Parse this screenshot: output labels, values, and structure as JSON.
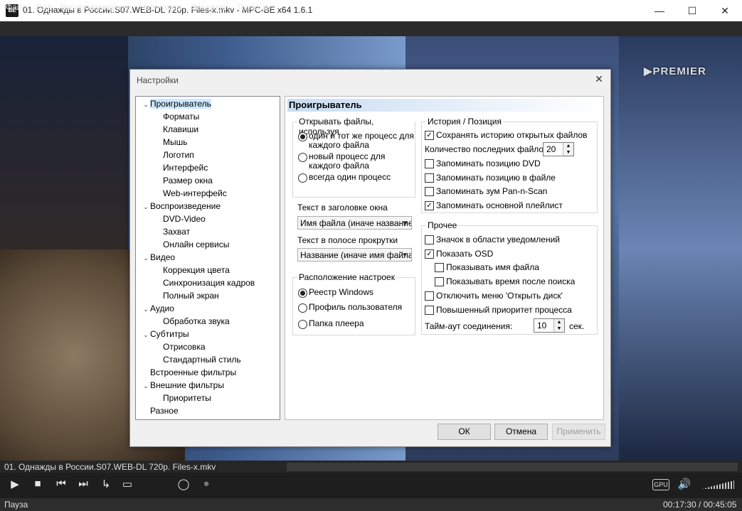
{
  "window": {
    "title": "01. Однажды в России.S07.WEB-DL 720p. Files-x.mkv - MPC-BE x64 1.6.1",
    "icon": "BE",
    "minimize": "—",
    "maximize": "☐",
    "close": "✕"
  },
  "menu": [
    "Файл",
    "Вид",
    "Воспроизведение",
    "Навигация",
    "Закладки",
    "Помощь"
  ],
  "video": {
    "watermark": "▶PREMIER"
  },
  "dialog": {
    "title": "Настройки",
    "close": "✕",
    "tree": [
      {
        "label": "Проигрыватель",
        "level": 0,
        "expandable": true,
        "selected": true
      },
      {
        "label": "Форматы",
        "level": 1
      },
      {
        "label": "Клавиши",
        "level": 1
      },
      {
        "label": "Мышь",
        "level": 1
      },
      {
        "label": "Логотип",
        "level": 1
      },
      {
        "label": "Интерфейс",
        "level": 1
      },
      {
        "label": "Размер окна",
        "level": 1
      },
      {
        "label": "Web-интерфейс",
        "level": 1
      },
      {
        "label": "Воспроизведение",
        "level": 0,
        "expandable": true
      },
      {
        "label": "DVD-Video",
        "level": 1
      },
      {
        "label": "Захват",
        "level": 1
      },
      {
        "label": "Онлайн сервисы",
        "level": 1
      },
      {
        "label": "Видео",
        "level": 0,
        "expandable": true
      },
      {
        "label": "Коррекция цвета",
        "level": 1
      },
      {
        "label": "Синхронизация кадров",
        "level": 1
      },
      {
        "label": "Полный экран",
        "level": 1
      },
      {
        "label": "Аудио",
        "level": 0,
        "expandable": true
      },
      {
        "label": "Обработка звука",
        "level": 1
      },
      {
        "label": "Субтитры",
        "level": 0,
        "expandable": true
      },
      {
        "label": "Отрисовка",
        "level": 1
      },
      {
        "label": "Стандартный стиль",
        "level": 1
      },
      {
        "label": "Встроенные фильтры",
        "level": 0,
        "expandable": false
      },
      {
        "label": "Внешние фильтры",
        "level": 0,
        "expandable": true
      },
      {
        "label": "Приоритеты",
        "level": 1
      },
      {
        "label": "Разное",
        "level": 0,
        "expandable": false
      }
    ],
    "panel": {
      "header": "Проигрыватель",
      "open_files": {
        "label": "Открывать файлы, используя",
        "opt1": "один и тот же процесс для каждого файла",
        "opt1_line1": "один и тот же процесс для",
        "opt1_line2": "каждого файла",
        "opt2_line1": "новый процесс для",
        "opt2_line2": "каждого файла",
        "opt3": "всегда один процесс",
        "selected": 1
      },
      "title_text": {
        "label": "Текст в заголовке окна",
        "value": "Имя файла (иначе название"
      },
      "seek_text": {
        "label": "Текст в полосе прокрутки",
        "value": "Название (иначе имя файла"
      },
      "settings_location": {
        "label": "Расположение настроек",
        "opt1": "Реестр Windows",
        "opt2": "Профиль пользователя",
        "opt3": "Папка плеера",
        "selected": 1
      },
      "history": {
        "label": "История / Позиция",
        "save_history": "Сохранять историю открытых файлов",
        "save_history_checked": true,
        "recent_count_label": "Количество последних файлов:",
        "recent_count": "20",
        "remember_dvd": "Запоминать позицию DVD",
        "remember_dvd_checked": false,
        "remember_file": "Запоминать позицию в файле",
        "remember_file_checked": false,
        "remember_zoom": "Запоминать зум Pan-n-Scan",
        "remember_zoom_checked": false,
        "remember_playlist": "Запоминать основной плейлист",
        "remember_playlist_checked": true
      },
      "misc": {
        "label": "Прочее",
        "tray_icon": "Значок в области уведомлений",
        "tray_icon_checked": false,
        "show_osd": "Показать OSD",
        "show_osd_checked": true,
        "show_filename": "Показывать имя файла",
        "show_filename_checked": false,
        "show_time_after_seek": "Показывать время после поиска",
        "show_time_after_seek_checked": false,
        "disable_open_disc": "Отключить меню 'Открыть диск'",
        "disable_open_disc_checked": false,
        "high_priority": "Повышенный приоритет процесса",
        "high_priority_checked": false,
        "timeout_label": "Тайм-аут соединения:",
        "timeout_value": "10",
        "timeout_unit": "сек."
      }
    },
    "buttons": {
      "ok": "ОК",
      "cancel": "Отмена",
      "apply": "Применить"
    }
  },
  "player": {
    "seek_text": "01. Однажды в России.S07.WEB-DL 720p. Files-x.mkv",
    "gpu": "GPU",
    "status": "Пауза",
    "time": "00:17:30 / 00:45:05"
  }
}
